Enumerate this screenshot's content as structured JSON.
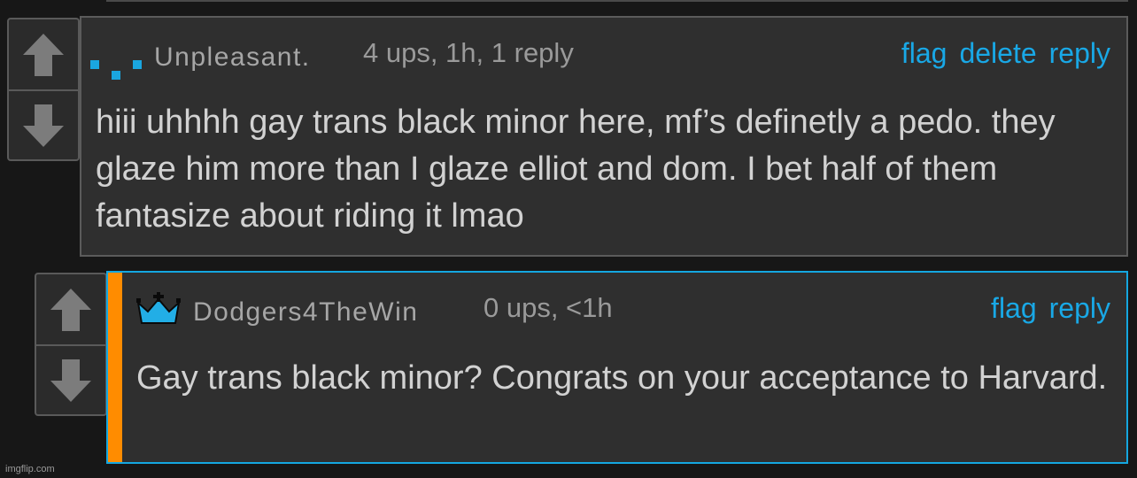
{
  "comments": [
    {
      "user": "Unpleasant.",
      "meta": "4 ups, 1h, 1 reply",
      "links": [
        "flag",
        "delete",
        "reply"
      ],
      "text": "hiii uhhhh gay trans black minor here, mf’s definetly a pedo. they glaze him more than I glaze elliot and dom. I bet half of them fantasize about riding it lmao",
      "badge_icon": "dots-badge-icon"
    },
    {
      "user": "Dodgers4TheWin",
      "meta": "0 ups, <1h",
      "links": [
        "flag",
        "reply"
      ],
      "text": "Gay trans black minor? Congrats on your acceptance to Harvard.",
      "badge_icon": "crown-icon"
    }
  ],
  "footer": "imgflip.com",
  "colors": {
    "background": "#171717",
    "comment_bg": "#2f2f2f",
    "link": "#19a8e6",
    "reply_border": "#14a7e0",
    "reply_accent": "#ff8c00"
  }
}
